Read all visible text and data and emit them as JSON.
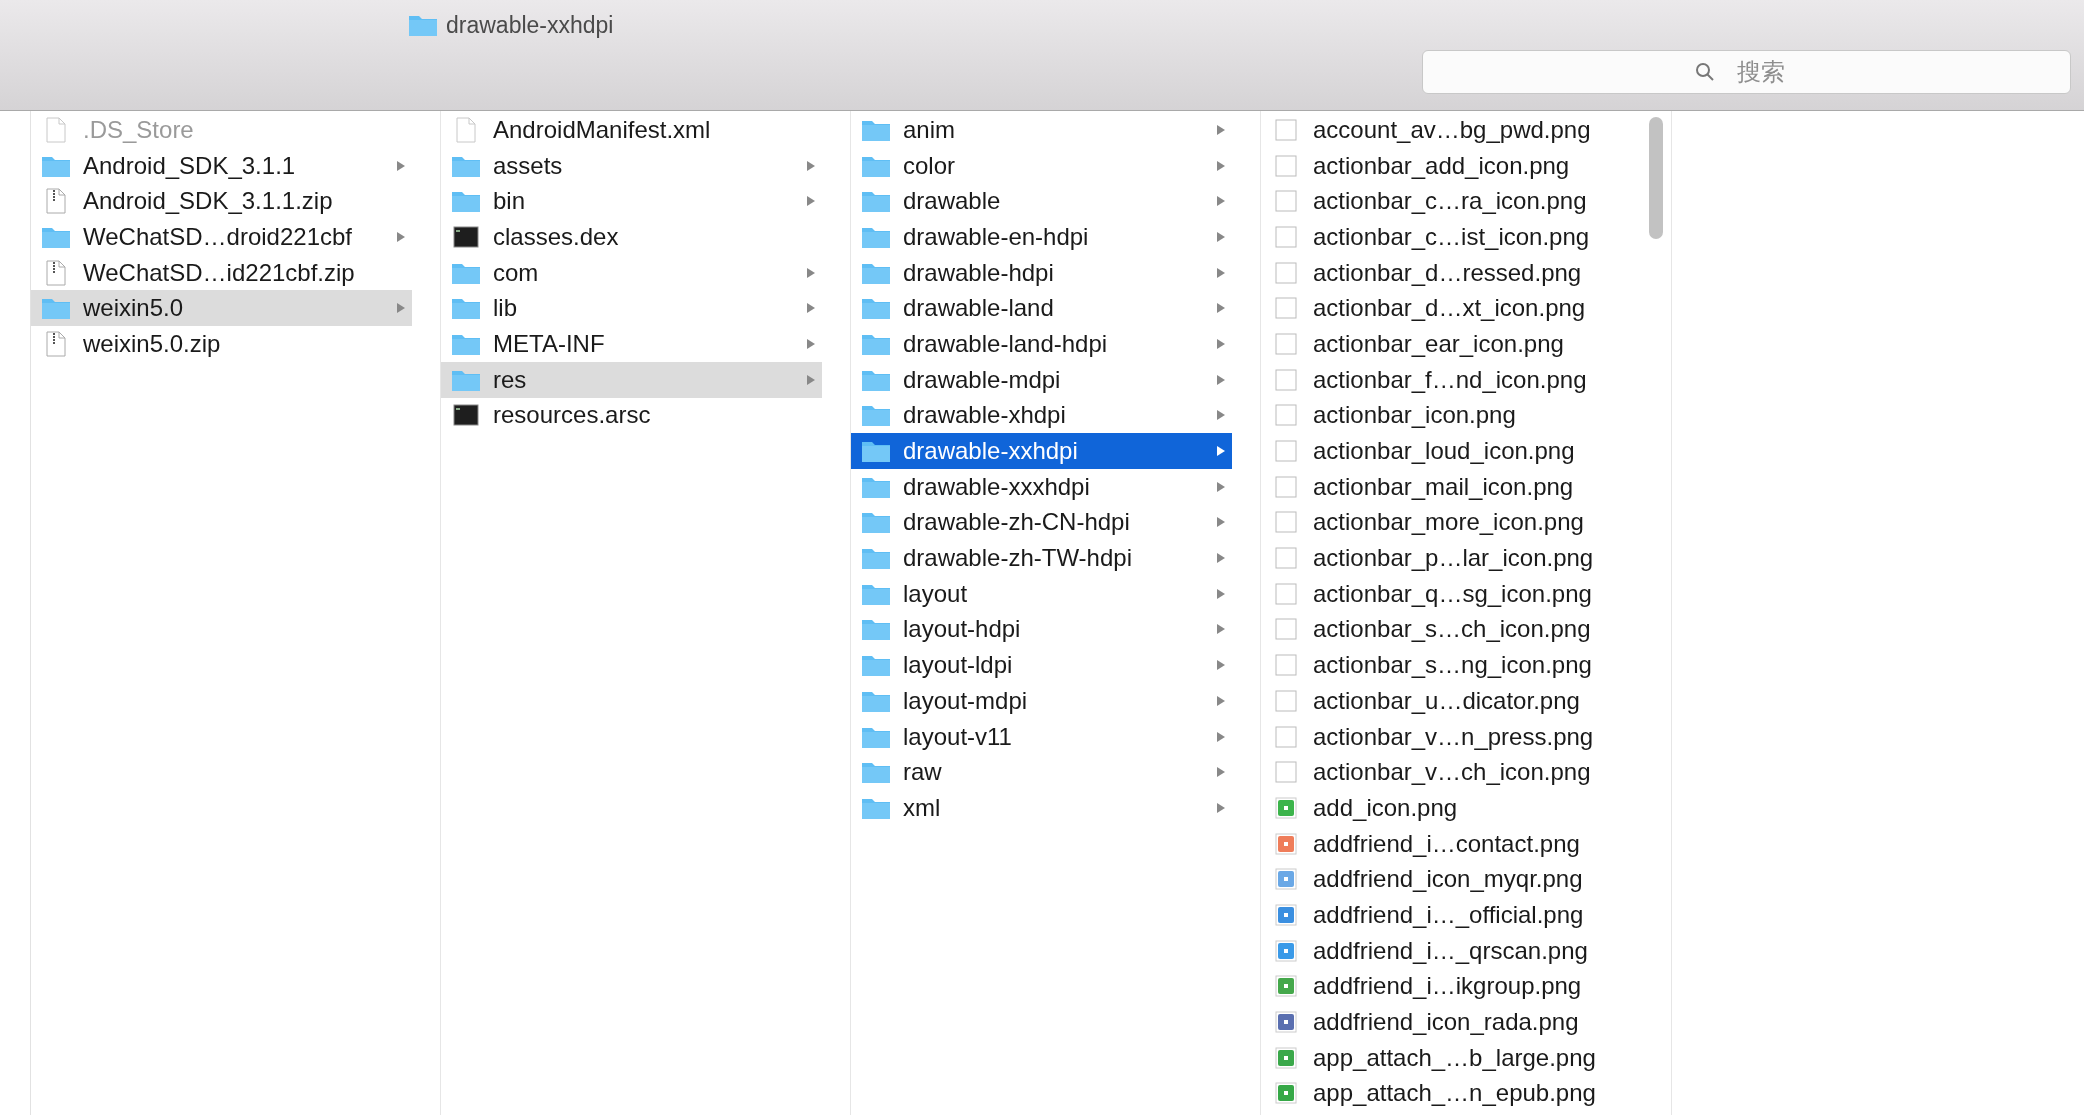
{
  "window": {
    "title": "drawable-xxhdpi"
  },
  "search": {
    "placeholder": "搜索"
  },
  "columns": [
    {
      "items": [
        {
          "name": ".DS_Store",
          "kind": "document",
          "selected": false,
          "hidden": true
        },
        {
          "name": "Android_SDK_3.1.1",
          "kind": "folder",
          "selected": false,
          "hidden": false
        },
        {
          "name": "Android_SDK_3.1.1.zip",
          "kind": "archive",
          "selected": false,
          "hidden": false
        },
        {
          "name": "WeChatSD…droid221cbf",
          "kind": "folder",
          "selected": false,
          "hidden": false
        },
        {
          "name": "WeChatSD…id221cbf.zip",
          "kind": "archive",
          "selected": false,
          "hidden": false
        },
        {
          "name": "weixin5.0",
          "kind": "folder",
          "selected": true,
          "hidden": false
        },
        {
          "name": "weixin5.0.zip",
          "kind": "archive",
          "selected": false,
          "hidden": false
        }
      ]
    },
    {
      "items": [
        {
          "name": "AndroidManifest.xml",
          "kind": "document",
          "selected": false
        },
        {
          "name": "assets",
          "kind": "folder",
          "selected": false
        },
        {
          "name": "bin",
          "kind": "folder",
          "selected": false
        },
        {
          "name": "classes.dex",
          "kind": "binary",
          "selected": false
        },
        {
          "name": "com",
          "kind": "folder",
          "selected": false
        },
        {
          "name": "lib",
          "kind": "folder",
          "selected": false
        },
        {
          "name": "META-INF",
          "kind": "folder",
          "selected": false
        },
        {
          "name": "res",
          "kind": "folder",
          "selected": true
        },
        {
          "name": "resources.arsc",
          "kind": "binary",
          "selected": false
        }
      ]
    },
    {
      "items": [
        {
          "name": "anim",
          "kind": "folder",
          "selected": false
        },
        {
          "name": "color",
          "kind": "folder",
          "selected": false
        },
        {
          "name": "drawable",
          "kind": "folder",
          "selected": false
        },
        {
          "name": "drawable-en-hdpi",
          "kind": "folder",
          "selected": false
        },
        {
          "name": "drawable-hdpi",
          "kind": "folder",
          "selected": false
        },
        {
          "name": "drawable-land",
          "kind": "folder",
          "selected": false
        },
        {
          "name": "drawable-land-hdpi",
          "kind": "folder",
          "selected": false
        },
        {
          "name": "drawable-mdpi",
          "kind": "folder",
          "selected": false
        },
        {
          "name": "drawable-xhdpi",
          "kind": "folder",
          "selected": false
        },
        {
          "name": "drawable-xxhdpi",
          "kind": "folder",
          "selected": true
        },
        {
          "name": "drawable-xxxhdpi",
          "kind": "folder",
          "selected": false
        },
        {
          "name": "drawable-zh-CN-hdpi",
          "kind": "folder",
          "selected": false
        },
        {
          "name": "drawable-zh-TW-hdpi",
          "kind": "folder",
          "selected": false
        },
        {
          "name": "layout",
          "kind": "folder",
          "selected": false
        },
        {
          "name": "layout-hdpi",
          "kind": "folder",
          "selected": false
        },
        {
          "name": "layout-ldpi",
          "kind": "folder",
          "selected": false
        },
        {
          "name": "layout-mdpi",
          "kind": "folder",
          "selected": false
        },
        {
          "name": "layout-v11",
          "kind": "folder",
          "selected": false
        },
        {
          "name": "raw",
          "kind": "folder",
          "selected": false
        },
        {
          "name": "xml",
          "kind": "folder",
          "selected": false
        }
      ]
    },
    {
      "items": [
        {
          "name": "account_av…bg_pwd.png",
          "kind": "image",
          "selected": false
        },
        {
          "name": "actionbar_add_icon.png",
          "kind": "image",
          "selected": false
        },
        {
          "name": "actionbar_c…ra_icon.png",
          "kind": "image",
          "selected": false
        },
        {
          "name": "actionbar_c…ist_icon.png",
          "kind": "image",
          "selected": false
        },
        {
          "name": "actionbar_d…ressed.png",
          "kind": "image",
          "selected": false
        },
        {
          "name": "actionbar_d…xt_icon.png",
          "kind": "image",
          "selected": false
        },
        {
          "name": "actionbar_ear_icon.png",
          "kind": "image",
          "selected": false
        },
        {
          "name": "actionbar_f…nd_icon.png",
          "kind": "image",
          "selected": false
        },
        {
          "name": "actionbar_icon.png",
          "kind": "image",
          "selected": false
        },
        {
          "name": "actionbar_loud_icon.png",
          "kind": "image",
          "selected": false
        },
        {
          "name": "actionbar_mail_icon.png",
          "kind": "image",
          "selected": false
        },
        {
          "name": "actionbar_more_icon.png",
          "kind": "image",
          "selected": false
        },
        {
          "name": "actionbar_p…lar_icon.png",
          "kind": "image",
          "selected": false
        },
        {
          "name": "actionbar_q…sg_icon.png",
          "kind": "image",
          "selected": false
        },
        {
          "name": "actionbar_s…ch_icon.png",
          "kind": "image",
          "selected": false
        },
        {
          "name": "actionbar_s…ng_icon.png",
          "kind": "image",
          "selected": false
        },
        {
          "name": "actionbar_u…dicator.png",
          "kind": "image",
          "selected": false
        },
        {
          "name": "actionbar_v…n_press.png",
          "kind": "image",
          "selected": false
        },
        {
          "name": "actionbar_v…ch_icon.png",
          "kind": "image",
          "selected": false
        },
        {
          "name": "add_icon.png",
          "kind": "image",
          "selected": false,
          "color": "#3cb44b"
        },
        {
          "name": "addfriend_i…contact.png",
          "kind": "image",
          "selected": false,
          "color": "#ef7d5a"
        },
        {
          "name": "addfriend_icon_myqr.png",
          "kind": "image",
          "selected": false,
          "color": "#6aa8e6"
        },
        {
          "name": "addfriend_i…_official.png",
          "kind": "image",
          "selected": false,
          "color": "#3b8fe0"
        },
        {
          "name": "addfriend_i…_qrscan.png",
          "kind": "image",
          "selected": false,
          "color": "#3a9ae8"
        },
        {
          "name": "addfriend_i…ikgroup.png",
          "kind": "image",
          "selected": false,
          "color": "#45a84b"
        },
        {
          "name": "addfriend_icon_rada.png",
          "kind": "image",
          "selected": false,
          "color": "#5a6fb0"
        },
        {
          "name": "app_attach_…b_large.png",
          "kind": "image",
          "selected": false,
          "color": "#3aa84a"
        },
        {
          "name": "app_attach_…n_epub.png",
          "kind": "image",
          "selected": false,
          "color": "#36a847"
        }
      ]
    }
  ]
}
